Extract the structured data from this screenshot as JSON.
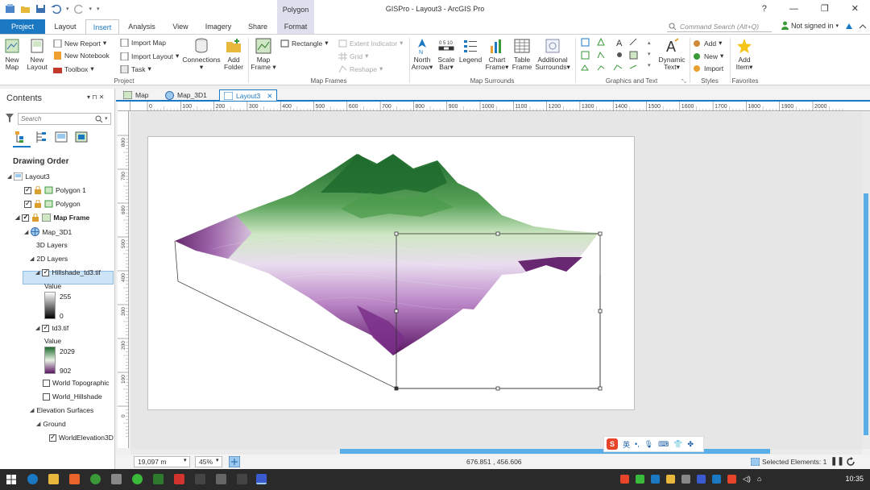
{
  "app": {
    "title": "GISPro - Layout3 - ArcGIS Pro",
    "context_tab_group": "Polygon",
    "help_glyph": "?",
    "minimize_glyph": "—",
    "restore_glyph": "❐",
    "close_glyph": "✕"
  },
  "tabs": [
    "Project",
    "Layout",
    "Insert",
    "Analysis",
    "View",
    "Imagery",
    "Share",
    "Format"
  ],
  "active_tab": "Insert",
  "command_search": {
    "placeholder": "Command Search (Alt+Q)"
  },
  "account": {
    "label": "Not signed in"
  },
  "ribbon": {
    "project": {
      "new_map": "New Map",
      "new_layout": "New Layout",
      "new_report": "New Report",
      "new_notebook": "New Notebook",
      "toolbox": "Toolbox",
      "import_map": "Import Map",
      "import_layout": "Import Layout",
      "task": "Task",
      "connections": "Connections",
      "add_folder": "Add Folder",
      "group_label": "Project"
    },
    "map_frames": {
      "map_frame": "Map Frame",
      "rectangle": "Rectangle",
      "extent_indicator": "Extent Indicator",
      "grid": "Grid",
      "reshape": "Reshape",
      "group_label": "Map Frames"
    },
    "map_surrounds": {
      "north_arrow": "North Arrow",
      "scale_bar": "Scale Bar",
      "legend": "Legend",
      "chart_frame": "Chart Frame",
      "table_frame": "Table Frame",
      "additional_surrounds": "Additional Surrounds",
      "group_label": "Map Surrounds"
    },
    "graphics_text": {
      "group_label": "Graphics and Text",
      "text_glyph": "A"
    },
    "styles": {
      "dynamic_text": "Dynamic Text",
      "add": "Add",
      "new": "New",
      "import": "Import",
      "group_label": "Styles"
    },
    "favorites": {
      "add_item": "Add Item",
      "group_label": "Favorites"
    },
    "scale_bar_ticks": "0 5 10"
  },
  "contents": {
    "title": "Contents",
    "pane_controls": "▾ ⊓ ✕",
    "search_placeholder": "Search",
    "heading": "Drawing Order",
    "tree": {
      "layout": "Layout3",
      "polygon1": "Polygon 1",
      "polygon": "Polygon",
      "map_frame": "Map Frame",
      "map3d": "Map_3D1",
      "layers_3d": "3D Layers",
      "layers_2d": "2D Layers",
      "hillshade": "Hillshade_td3.tif",
      "hillshade_value_label": "Value",
      "hillshade_max": "255",
      "hillshade_min": "0",
      "td3": "td3.tif",
      "td3_value_label": "Value",
      "td3_max": "2029",
      "td3_min": "902",
      "world_topo": "World Topographic",
      "world_hillshade": "World_Hillshade",
      "elev_surfaces": "Elevation Surfaces",
      "ground": "Ground",
      "world_elev": "WorldElevation3D"
    }
  },
  "view_tabs": [
    "Map",
    "Map_3D1",
    "Layout3"
  ],
  "active_view_tab": "Layout3",
  "ruler": {
    "h_ticks": [
      "0",
      "100",
      "200",
      "300",
      "400",
      "500",
      "600",
      "700",
      "800",
      "900",
      "1000",
      "1100",
      "1200",
      "1300",
      "1400",
      "1500",
      "1600",
      "1700",
      "1800",
      "1900",
      "2000"
    ],
    "v_ticks": [
      "800",
      "700",
      "600",
      "500",
      "400",
      "300",
      "200",
      "100",
      "0"
    ]
  },
  "status": {
    "scale": "19,097 m",
    "zoom": "45%",
    "coords": "676.851 , 456.606",
    "selected": "Selected Elements: 1"
  },
  "ime": {
    "lang": "英",
    "brand": "S"
  },
  "taskbar": {
    "time": "10:35"
  },
  "colors": {
    "accent": "#1b79c4",
    "terrain_high": "#1f6b2e",
    "terrain_mid": "#e8f2e4",
    "terrain_low": "#5a1463"
  }
}
